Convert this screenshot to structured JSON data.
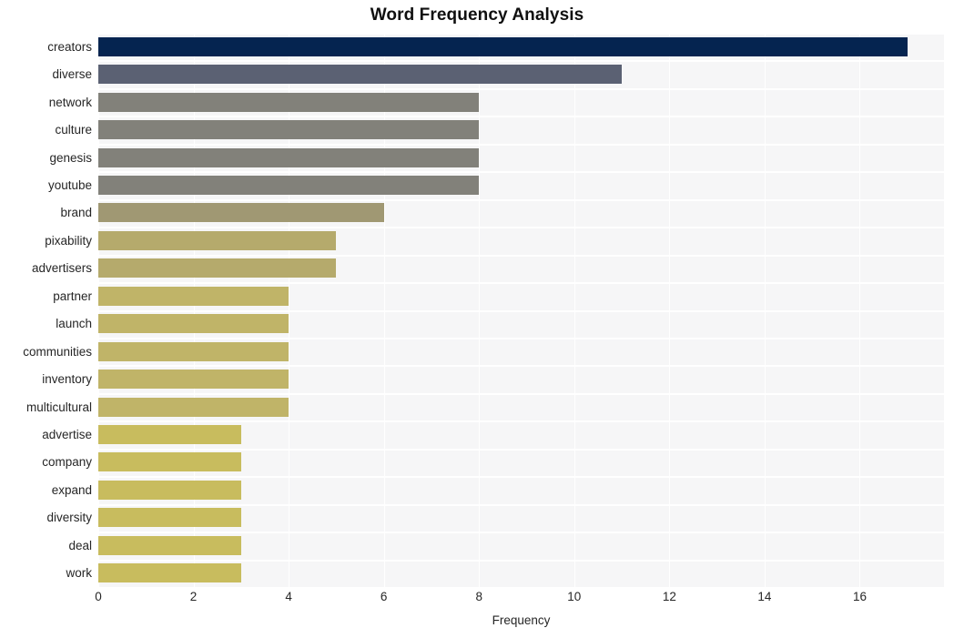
{
  "chart_data": {
    "type": "bar",
    "orientation": "horizontal",
    "title": "Word Frequency Analysis",
    "xlabel": "Frequency",
    "ylabel": "",
    "categories": [
      "creators",
      "diverse",
      "network",
      "culture",
      "genesis",
      "youtube",
      "brand",
      "pixability",
      "advertisers",
      "partner",
      "launch",
      "communities",
      "inventory",
      "multicultural",
      "advertise",
      "company",
      "expand",
      "diversity",
      "deal",
      "work"
    ],
    "values": [
      17,
      11,
      8,
      8,
      8,
      8,
      6,
      5,
      5,
      4,
      4,
      4,
      4,
      4,
      3,
      3,
      3,
      3,
      3,
      3
    ],
    "bar_colors": [
      "#052450",
      "#5b6173",
      "#82817a",
      "#82817a",
      "#82817a",
      "#82817a",
      "#a09873",
      "#b5aa6c",
      "#b5aa6c",
      "#c0b468",
      "#c0b468",
      "#c0b468",
      "#c0b468",
      "#c0b468",
      "#c8bc5e",
      "#c8bc5e",
      "#c8bc5e",
      "#c8bc5e",
      "#c8bc5e",
      "#c8bc5e"
    ],
    "xticks": [
      0,
      2,
      4,
      6,
      8,
      10,
      12,
      14,
      16
    ],
    "xlim": [
      0,
      17.77
    ],
    "grid": true,
    "legend": "none",
    "plot_background": "#f6f6f7",
    "figure_background": "#ffffff"
  }
}
